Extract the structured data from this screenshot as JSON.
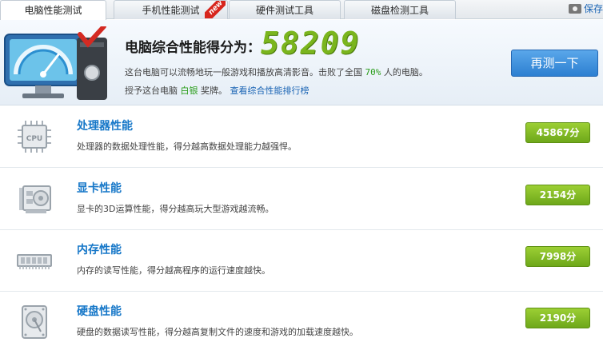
{
  "tabs": [
    {
      "label": "电脑性能测试",
      "active": true
    },
    {
      "label": "手机性能测试",
      "badge": "new"
    },
    {
      "label": "硬件测试工具"
    },
    {
      "label": "磁盘检测工具"
    }
  ],
  "toolbar": {
    "save_label": "保存"
  },
  "summary": {
    "title": "电脑综合性能得分为：",
    "score": "58209",
    "desc_prefix": "这台电脑可以流畅地玩一般游戏和播放高清影音。击败了全国",
    "desc_percent": "70%",
    "desc_suffix": "人的电脑。",
    "award_prefix": "授予这台电脑",
    "award_medal": "白银",
    "award_suffix": "奖牌。",
    "rank_link": "查看综合性能排行榜",
    "retest_label": "再测一下"
  },
  "items": [
    {
      "title": "处理器性能",
      "desc": "处理器的数据处理性能，得分越高数据处理能力越强悍。",
      "score": "45867分",
      "icon": "cpu-icon",
      "icon_text": "CPU"
    },
    {
      "title": "显卡性能",
      "desc": "显卡的3D运算性能，得分越高玩大型游戏越流畅。",
      "score": "2154分",
      "icon": "graphics-card-icon"
    },
    {
      "title": "内存性能",
      "desc": "内存的读写性能，得分越高程序的运行速度越快。",
      "score": "7998分",
      "icon": "memory-icon"
    },
    {
      "title": "硬盘性能",
      "desc": "硬盘的数据读写性能，得分越高复制文件的速度和游戏的加载速度越快。",
      "score": "2190分",
      "icon": "hard-disk-icon"
    }
  ],
  "colors": {
    "accent_blue": "#1677c8",
    "score_green": "#7ab51d",
    "button_blue": "#2c7fd1"
  }
}
